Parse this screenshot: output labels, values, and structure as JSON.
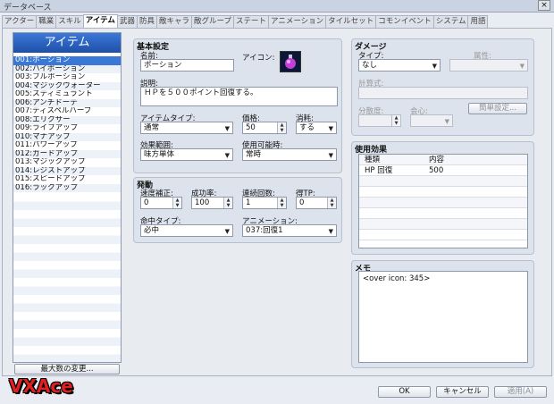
{
  "window": {
    "title": "データベース",
    "close": "×"
  },
  "tabs": [
    "アクター",
    "職業",
    "スキル",
    "アイテム",
    "武器",
    "防具",
    "敵キャラ",
    "敵グループ",
    "ステート",
    "アニメーション",
    "タイルセット",
    "コモンイベント",
    "システム",
    "用語"
  ],
  "active_tab": 3,
  "list": {
    "header": "アイテム",
    "items": [
      "001:ポーション",
      "002:ハイポーション",
      "003:フルポーション",
      "004:マジックウォーター",
      "005:スティミュラント",
      "006:アンチドーテ",
      "007:ディスペルハーブ",
      "008:エリクサー",
      "009:ライフアップ",
      "010:マナアップ",
      "011:パワーアップ",
      "012:ガードアップ",
      "013:マジックアップ",
      "014:レジストアップ",
      "015:スピードアップ",
      "016:ラックアップ"
    ],
    "selected": 0,
    "max_button": "最大数の変更..."
  },
  "basic": {
    "title": "基本設定",
    "name_label": "名前:",
    "name_value": "ポーション",
    "icon_label": "アイコン:",
    "icon_name": "potion-icon",
    "desc_label": "説明:",
    "desc_value": "ＨＰを５００ポイント回復する。",
    "type_label": "アイテムタイプ:",
    "type_value": "通常",
    "price_label": "価格:",
    "price_value": "50",
    "consume_label": "消耗:",
    "consume_value": "する",
    "scope_label": "効果範囲:",
    "scope_value": "味方単体",
    "occasion_label": "使用可能時:",
    "occasion_value": "常時"
  },
  "invocation": {
    "title": "発動",
    "speed_label": "速度補正:",
    "speed_value": "0",
    "success_label": "成功率:",
    "success_value": "100",
    "repeat_label": "連続回数:",
    "repeat_value": "1",
    "tp_label": "得TP:",
    "tp_value": "0",
    "hit_label": "命中タイプ:",
    "hit_value": "必中",
    "anim_label": "アニメーション:",
    "anim_value": "037:回復1"
  },
  "damage": {
    "title": "ダメージ",
    "type_label": "タイプ:",
    "type_value": "なし",
    "element_label": "属性:",
    "formula_label": "計算式:",
    "variance_label": "分散度:",
    "critical_label": "会心:",
    "simple_button": "簡単設定..."
  },
  "effects": {
    "title": "使用効果",
    "col_type": "種類",
    "col_content": "内容",
    "rows": [
      {
        "type": "HP 回復",
        "content": "500"
      }
    ]
  },
  "note": {
    "title": "メモ",
    "value": "<over icon: 345>"
  },
  "footer": {
    "ok": "OK",
    "cancel": "キャンセル",
    "apply": "適用(A)"
  },
  "logo": "VXAce"
}
